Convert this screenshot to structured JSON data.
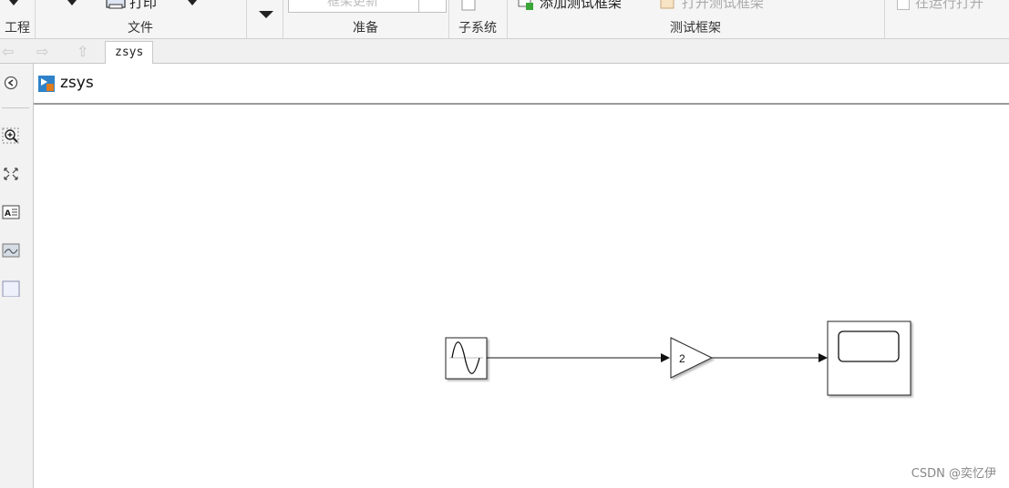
{
  "ribbon": {
    "sections": [
      {
        "label": "工程"
      },
      {
        "label": "文件",
        "print_label": "打印"
      },
      {
        "label": "准备",
        "field_value": "框架更新"
      },
      {
        "label": "子系统"
      },
      {
        "label": "测试框架",
        "add_label": "添加测试框架",
        "open_label": "打开测试框架"
      },
      {
        "label": "",
        "check_label": "在运行打开"
      }
    ]
  },
  "nav": {
    "tab": "zsys"
  },
  "address": {
    "path": "zsys"
  },
  "model": {
    "blocks": [
      {
        "type": "sine-wave",
        "label": ""
      },
      {
        "type": "gain",
        "label": "2"
      },
      {
        "type": "scope",
        "label": ""
      }
    ]
  },
  "watermark": "CSDN @奕忆伊",
  "colors": {
    "ribbon_bg": "#f5f5f5",
    "accent_green": "#3aa63a",
    "accent_orange": "#e07b20"
  }
}
